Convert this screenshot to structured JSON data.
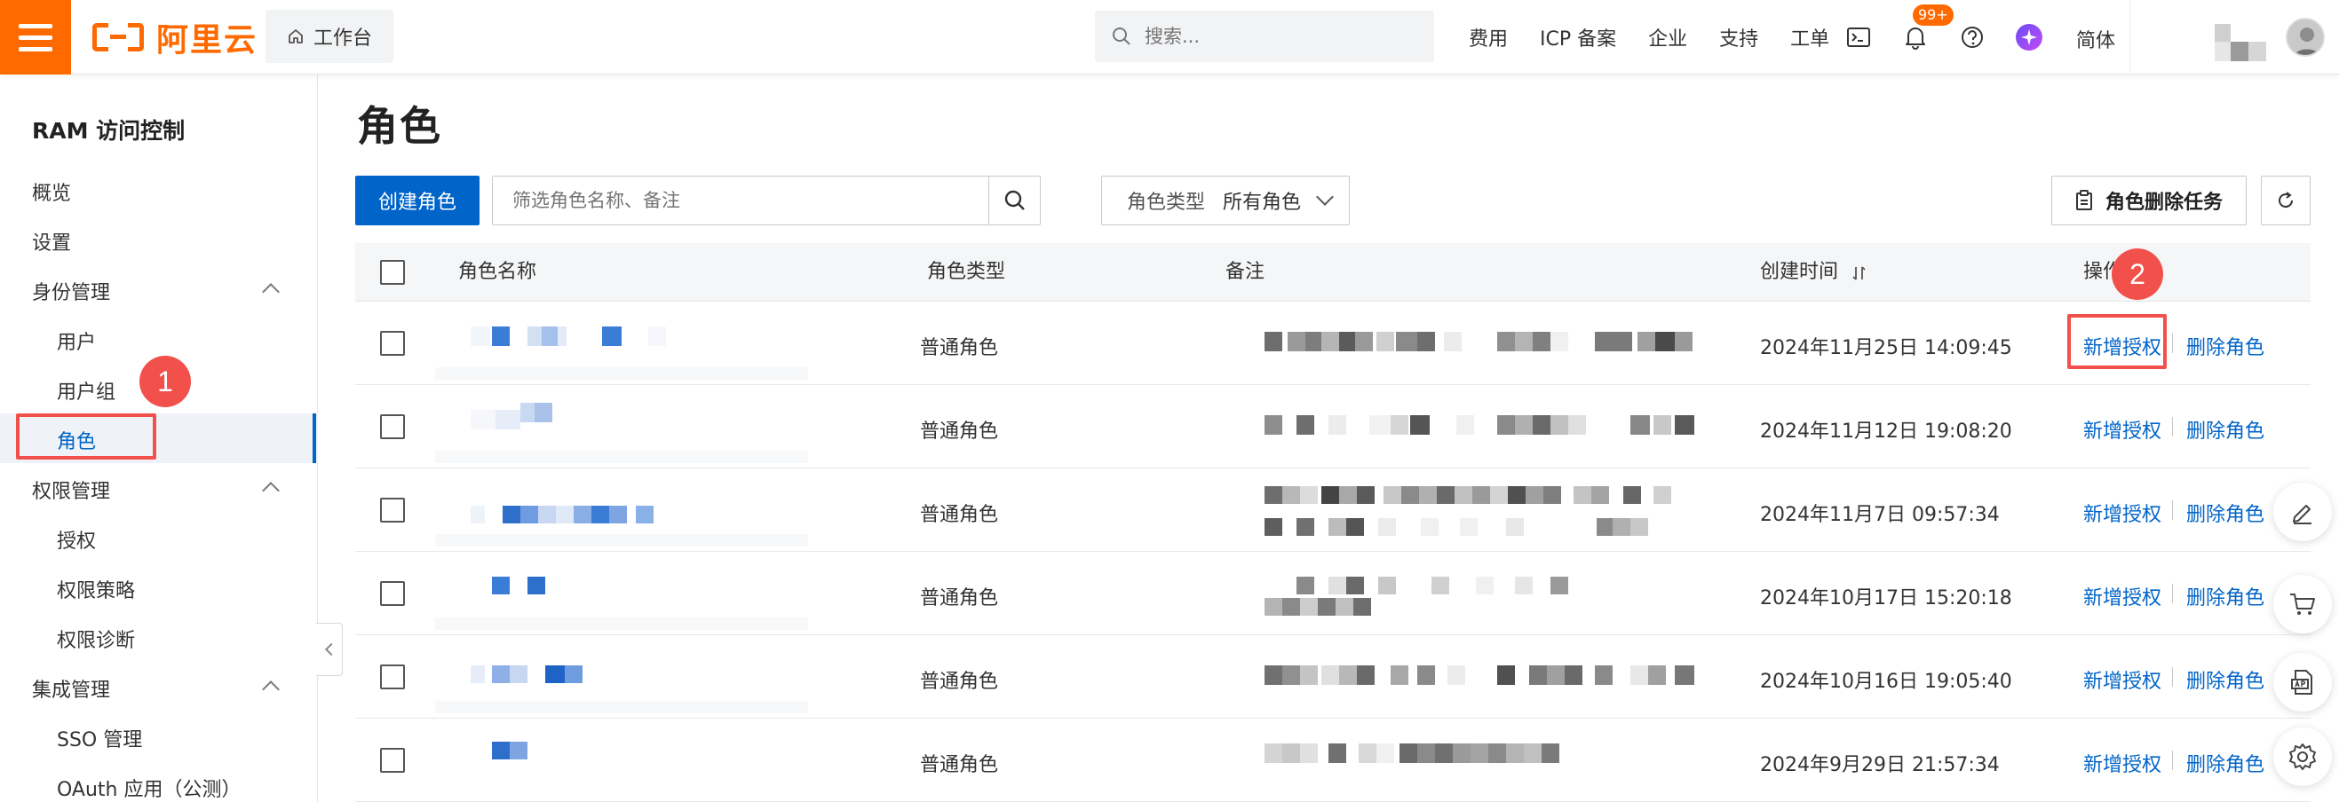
{
  "brand": {
    "name": "阿里云",
    "accent": "#ff6a00"
  },
  "header": {
    "workbench_label": "工作台",
    "search_placeholder": "搜索...",
    "nav": [
      "费用",
      "ICP 备案",
      "企业",
      "支持",
      "工单"
    ],
    "notification_count": "99+",
    "language": "简体",
    "icons": [
      "terminal-icon",
      "bell-icon",
      "help-icon",
      "ai-assistant-icon"
    ]
  },
  "sidebar": {
    "title": "RAM 访问控制",
    "items": {
      "overview": "概览",
      "settings": "设置",
      "identity_group": "身份管理",
      "users": "用户",
      "user_groups": "用户组",
      "roles": "角色",
      "permission_group": "权限管理",
      "grants": "授权",
      "policies": "权限策略",
      "diagnosis": "权限诊断",
      "integration_group": "集成管理",
      "sso": "SSO 管理",
      "oauth": "OAuth 应用（公测）"
    }
  },
  "annotations": {
    "step1": "1",
    "step2": "2",
    "highlight_color": "#f2504b"
  },
  "main": {
    "title": "角色",
    "create_button": "创建角色",
    "filter_placeholder": "筛选角色名称、备注",
    "role_type_label": "角色类型",
    "role_type_value": "所有角色",
    "delete_task_button": "角色删除任务",
    "columns": {
      "name": "角色名称",
      "type": "角色类型",
      "note": "备注",
      "created": "创建时间",
      "actions": "操作"
    },
    "rows": [
      {
        "type": "普通角色",
        "created": "2024年11月25日 14:09:45",
        "grant": "新增授权",
        "delete": "删除角色"
      },
      {
        "type": "普通角色",
        "created": "2024年11月12日 19:08:20",
        "grant": "新增授权",
        "delete": "删除角色"
      },
      {
        "type": "普通角色",
        "created": "2024年11月7日 09:57:34",
        "grant": "新增授权",
        "delete": "删除角色"
      },
      {
        "type": "普通角色",
        "created": "2024年10月17日 15:20:18",
        "grant": "新增授权",
        "delete": "删除角色"
      },
      {
        "type": "普通角色",
        "created": "2024年10月16日 19:05:40",
        "grant": "新增授权",
        "delete": "删除角色"
      },
      {
        "type": "普通角色",
        "created": "2024年9月29日 21:57:34",
        "grant": "新增授权",
        "delete": "删除角色"
      }
    ]
  },
  "float_tools": [
    "edit-icon",
    "cart-icon",
    "api-icon",
    "gear-icon"
  ],
  "colors": {
    "primary": "#0064c8",
    "link": "#0064c8",
    "header_bg": "#f5f6f7"
  }
}
